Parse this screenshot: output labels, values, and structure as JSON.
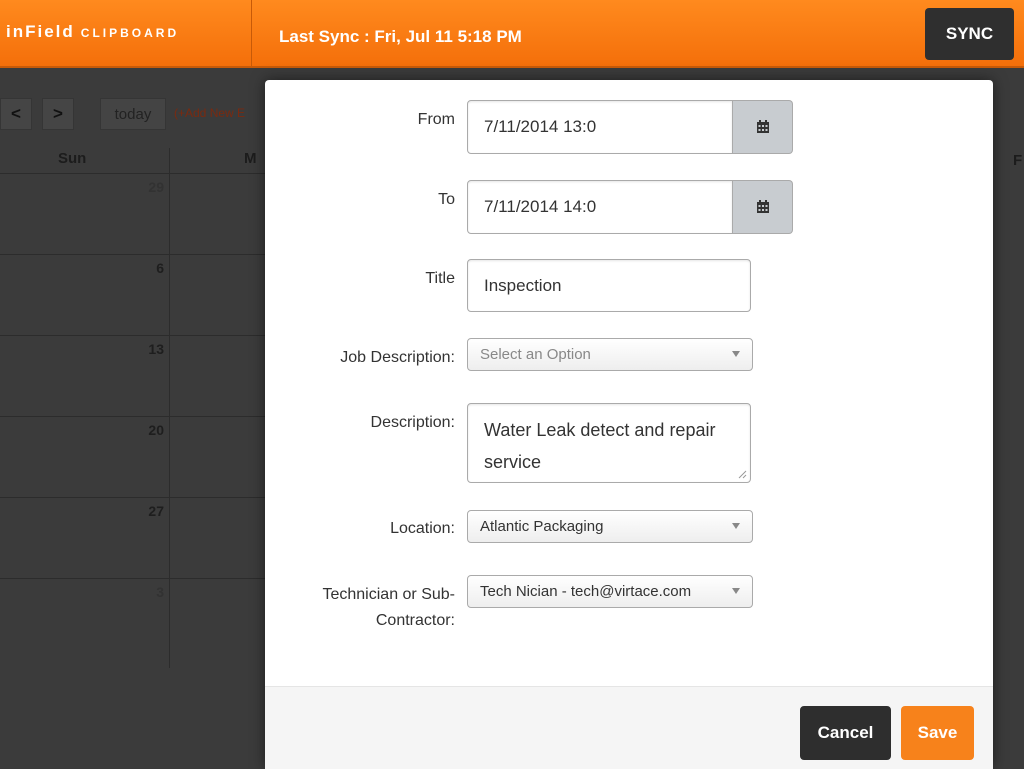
{
  "header": {
    "logo_main": "inField",
    "logo_sub": "CLIPBOARD",
    "last_sync": "Last Sync : Fri, Jul 11 5:18 PM",
    "sync_label": "SYNC"
  },
  "calendar": {
    "prev": "<",
    "next": ">",
    "today": "today",
    "add_new": "(+Add New E",
    "days": [
      "Sun",
      "M",
      "F"
    ],
    "dates": [
      "29",
      "6",
      "13",
      "20",
      "27",
      "3"
    ]
  },
  "form": {
    "from_label": "From",
    "from_value": "7/11/2014 13:0",
    "to_label": "To",
    "to_value": "7/11/2014 14:0",
    "title_label": "Title",
    "title_value": "Inspection",
    "job_desc_label": "Job Description:",
    "job_desc_value": "Select an Option",
    "desc_label": "Description:",
    "desc_value": "Water Leak detect and repair service",
    "location_label": "Location:",
    "location_value": "Atlantic Packaging",
    "tech_label": "Technician or Sub-Contractor:",
    "tech_value": "Tech Nician - tech@virtace.com"
  },
  "footer": {
    "cancel": "Cancel",
    "save": "Save"
  },
  "colors": {
    "brand_orange": "#f7821b",
    "dark_button": "#2e2e2e"
  }
}
